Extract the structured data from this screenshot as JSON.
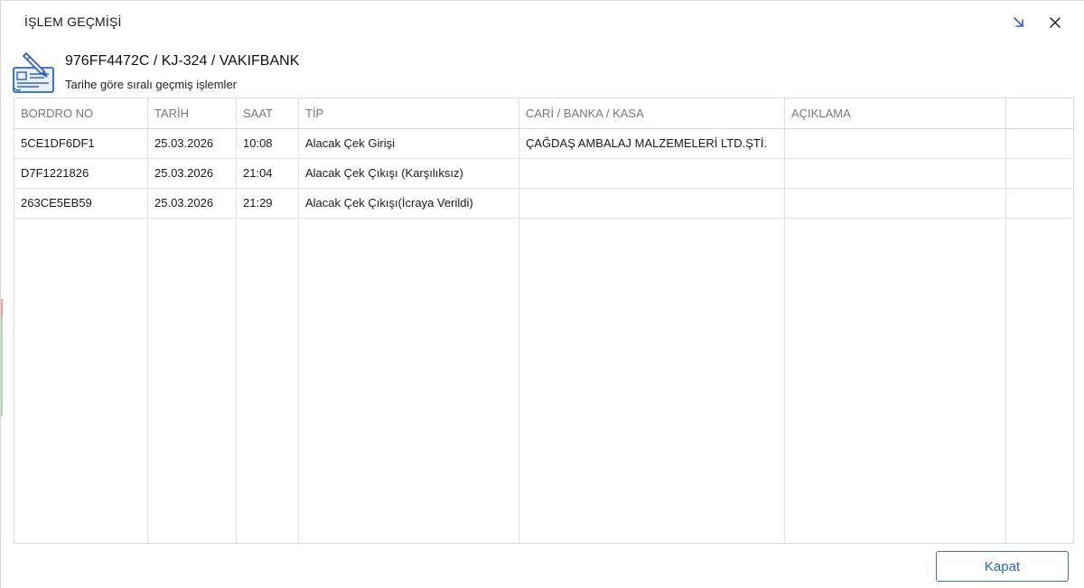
{
  "window": {
    "title": "İŞLEM GEÇMİŞİ"
  },
  "header": {
    "title": "976FF4472C / KJ-324 / VAKIFBANK",
    "subtitle": "Tarihe göre sıralı geçmiş işlemler",
    "icon": "check-document-icon"
  },
  "table": {
    "columns": [
      "BORDRO NO",
      "TARİH",
      "SAAT",
      "TİP",
      "CARİ / BANKA / KASA",
      "AÇIKLAMA",
      ""
    ],
    "rows": [
      {
        "bordro_no": "5CE1DF6DF1",
        "tarih": "25.03.2026",
        "saat": "10:08",
        "tip": "Alacak Çek Girişi",
        "cari": "ÇAĞDAŞ AMBALAJ MALZEMELERİ LTD.ŞTİ.",
        "aciklama": ""
      },
      {
        "bordro_no": "D7F1221826",
        "tarih": "25.03.2026",
        "saat": "21:04",
        "tip": "Alacak Çek Çıkışı (Karşılıksız)",
        "cari": "",
        "aciklama": ""
      },
      {
        "bordro_no": "263CE5EB59",
        "tarih": "25.03.2026",
        "saat": "21:29",
        "tip": "Alacak Çek Çıkışı(İcraya Verildi)",
        "cari": "",
        "aciklama": ""
      }
    ]
  },
  "footer": {
    "close_label": "Kapat"
  },
  "colors": {
    "accent": "#2f62c8",
    "border": "#dcdcdc",
    "header_text": "#777777"
  }
}
